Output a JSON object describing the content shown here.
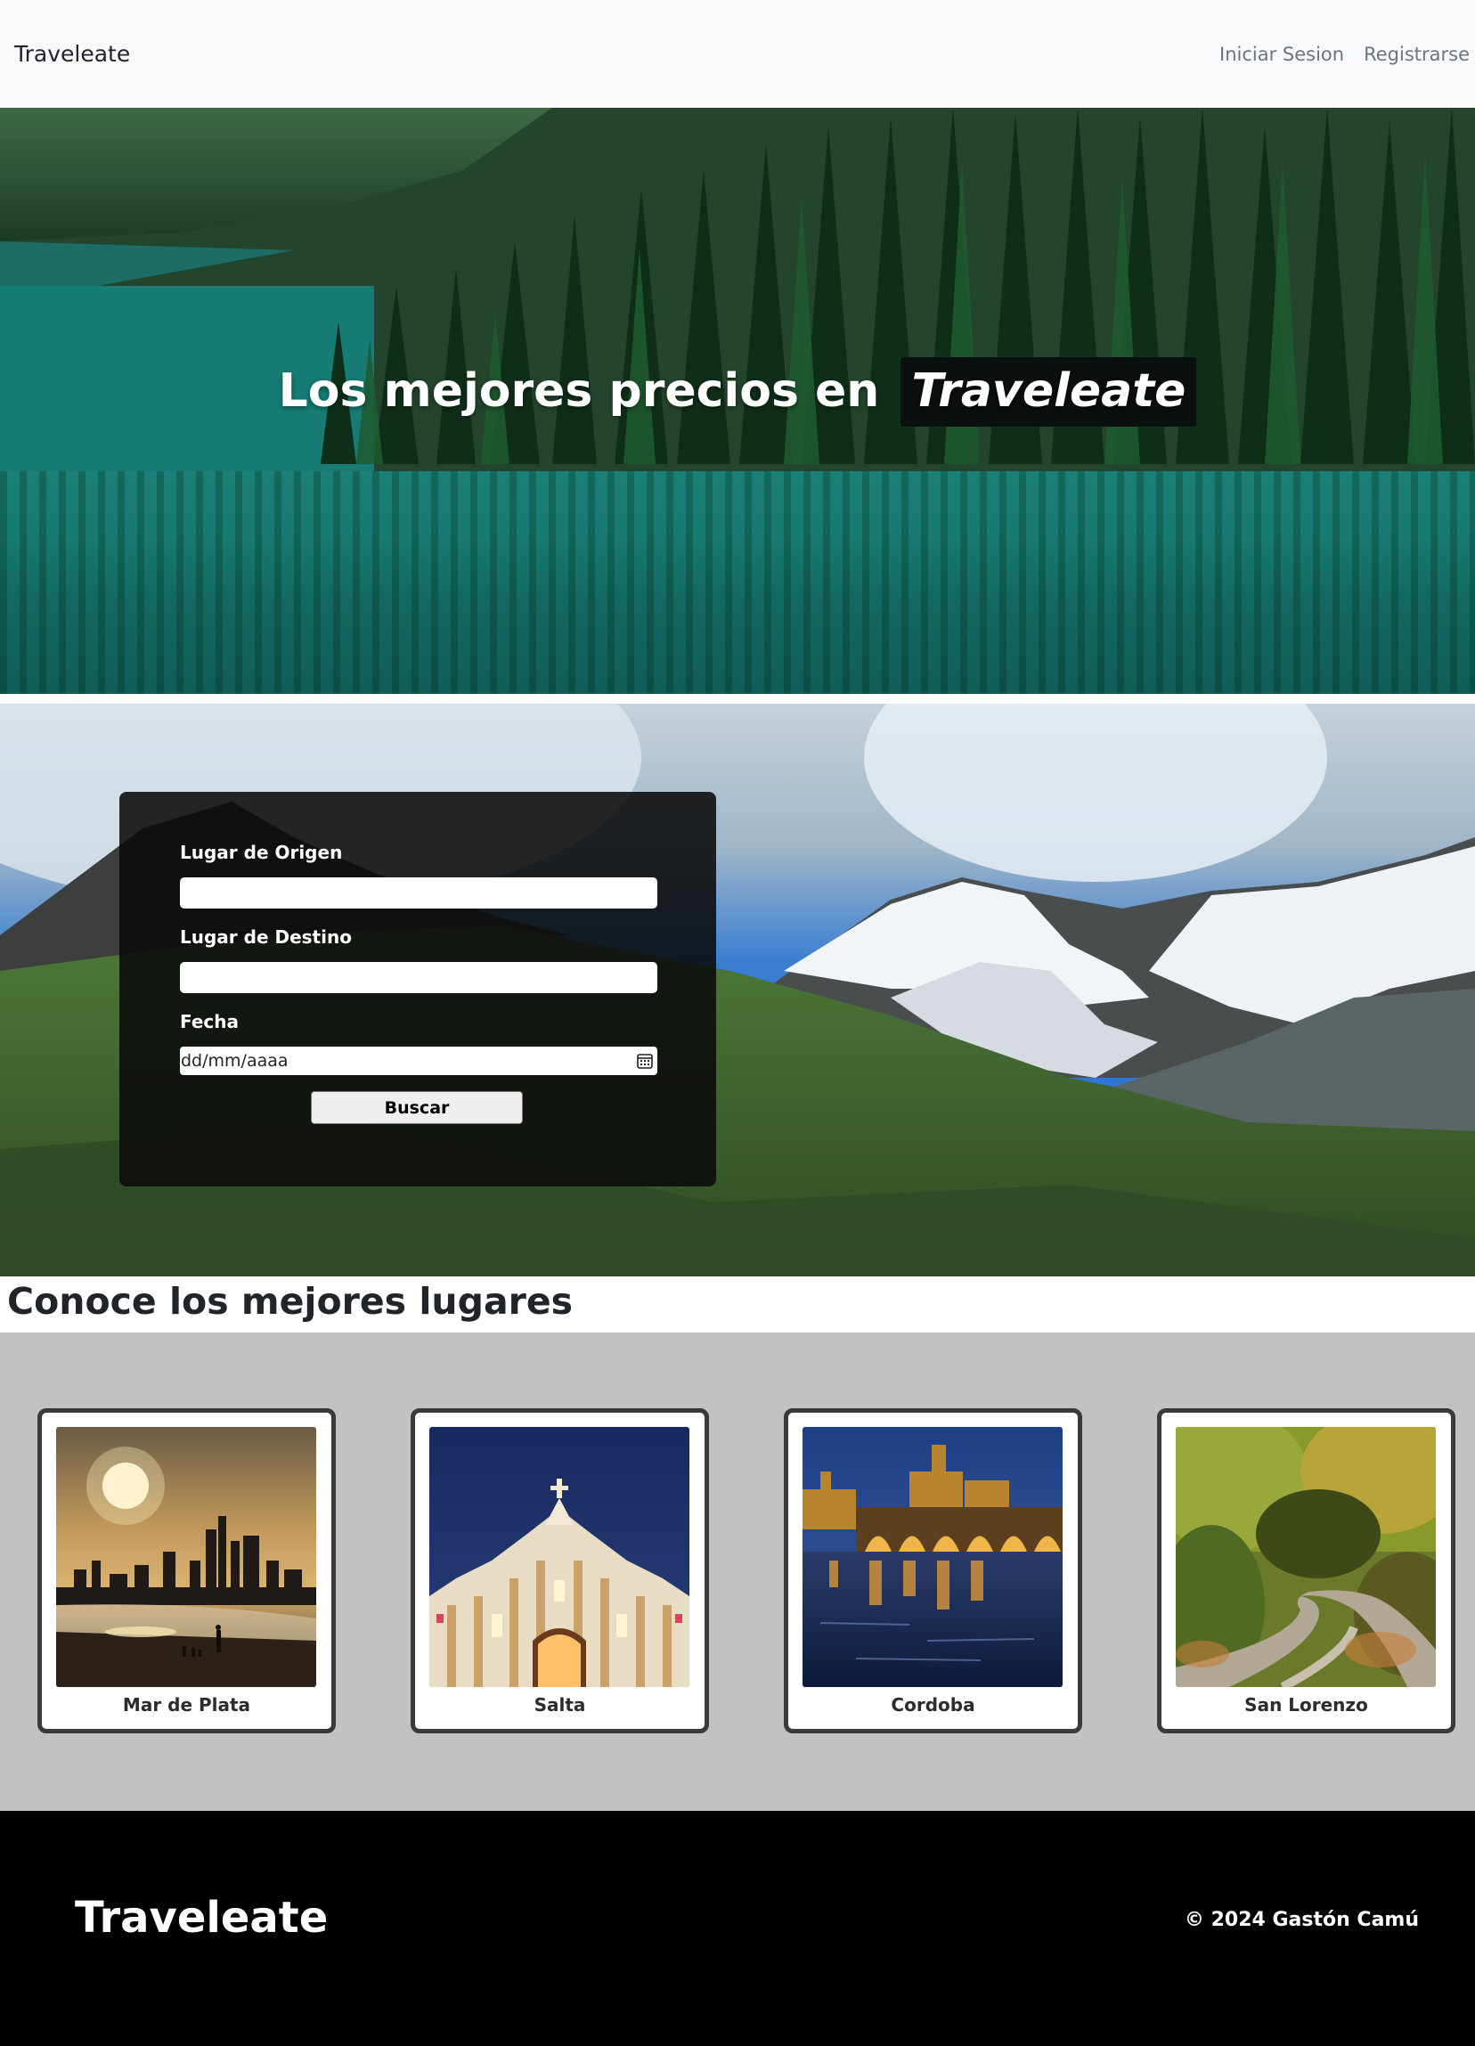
{
  "navbar": {
    "brand": "Traveleate",
    "links": [
      "Iniciar Sesion",
      "Registrarse"
    ]
  },
  "hero": {
    "title_prefix": "Los mejores precios en",
    "title_brand": "Traveleate"
  },
  "search": {
    "origin_label": "Lugar de Origen",
    "origin_value": "",
    "destination_label": "Lugar de Destino",
    "destination_value": "",
    "date_label": "Fecha",
    "date_placeholder": "dd/mm/aaaa",
    "button_label": "Buscar"
  },
  "places": {
    "heading": "Conoce los mejores lugares",
    "items": [
      {
        "name": "Mar de Plata",
        "icon": "sunset-beach-skyline-image"
      },
      {
        "name": "Salta",
        "icon": "cathedral-night-image"
      },
      {
        "name": "Cordoba",
        "icon": "bridge-night-image"
      },
      {
        "name": "San Lorenzo",
        "icon": "forest-road-image"
      }
    ]
  },
  "footer": {
    "brand": "Traveleate",
    "copyright": "© 2024 Gastón Camú"
  },
  "colors": {
    "navbar_bg": "#f8f9fa",
    "places_bg": "#c2c2c2",
    "footer_bg": "#000000",
    "card_border": "#3a3a3a"
  }
}
